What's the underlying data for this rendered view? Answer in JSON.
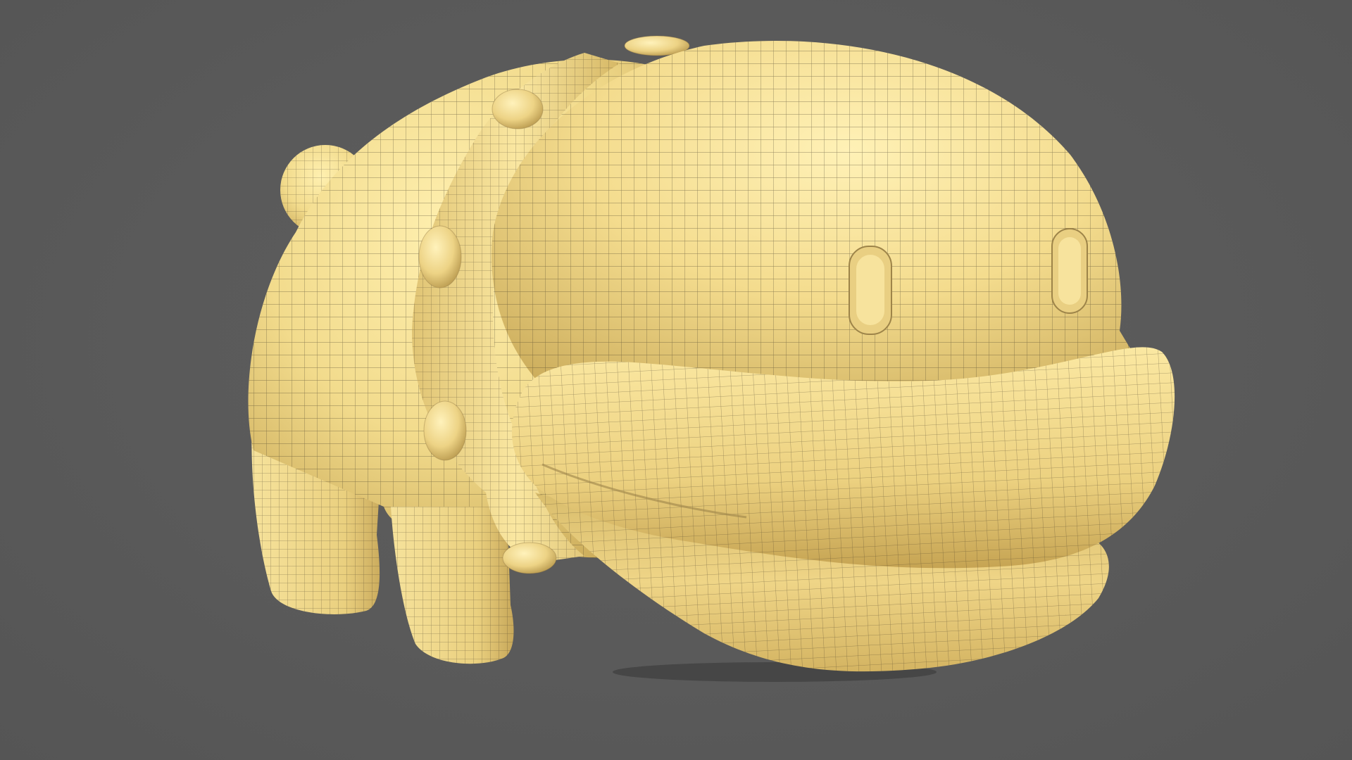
{
  "viewport": {
    "background_color": "#595959",
    "shading": "wireframe-on-shaded",
    "view": "perspective"
  },
  "model": {
    "subject": "hippo-with-collar",
    "base_color": "#f2db8c",
    "shadow_color": "#c9a957",
    "highlight_color": "#fff0b0",
    "wire_color": "#3a3222",
    "parts": [
      "tail-ball",
      "body",
      "rear-leg",
      "front-leg",
      "collar",
      "collar-studs",
      "head-dome",
      "nostrils",
      "upper-lip",
      "lower-jaw"
    ]
  }
}
